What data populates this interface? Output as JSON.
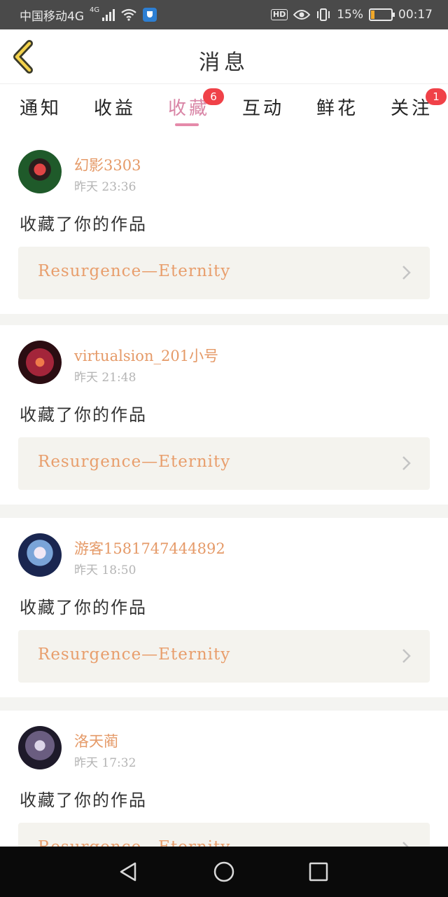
{
  "status_bar": {
    "carrier": "中国移动4G",
    "network": "4G",
    "battery": "15%",
    "battery_level": 0.15,
    "time": "00:17",
    "hd_label": "HD",
    "icons": [
      "signal-icon",
      "wifi-icon",
      "shield-icon",
      "hd-icon",
      "eye-icon",
      "vibrate-icon",
      "battery-icon"
    ]
  },
  "header": {
    "title": "消息",
    "back_icon": "chevron-left-icon"
  },
  "tabs": [
    {
      "label": "通知",
      "badge": null,
      "active": false
    },
    {
      "label": "收益",
      "badge": null,
      "active": false
    },
    {
      "label": "收藏",
      "badge": "6",
      "active": true
    },
    {
      "label": "互动",
      "badge": null,
      "active": false
    },
    {
      "label": "鲜花",
      "badge": null,
      "active": false
    },
    {
      "label": "关注",
      "badge": "1",
      "active": false
    }
  ],
  "feed": [
    {
      "username": "幻影3303",
      "time": "昨天 23:36",
      "action": "收藏了你的作品",
      "work_title": "Resurgence—Eternity"
    },
    {
      "username": "virtualsion_201小号",
      "time": "昨天 21:48",
      "action": "收藏了你的作品",
      "work_title": "Resurgence—Eternity"
    },
    {
      "username": "游客15817474448​92",
      "time": "昨天 18:50",
      "action": "收藏了你的作品",
      "work_title": "Resurgence—Eternity"
    },
    {
      "username": "洛天蔺",
      "time": "昨天 17:32",
      "action": "收藏了你的作品",
      "work_title": "Resurgence—Eternity"
    }
  ],
  "colors": {
    "accent_pink": "#e58aaa",
    "username_orange": "#e59a68",
    "badge_red": "#f04148",
    "card_bg": "#f4f3ee"
  },
  "nav_bar": {
    "icons": [
      "back-triangle-icon",
      "home-circle-icon",
      "recents-square-icon"
    ]
  }
}
